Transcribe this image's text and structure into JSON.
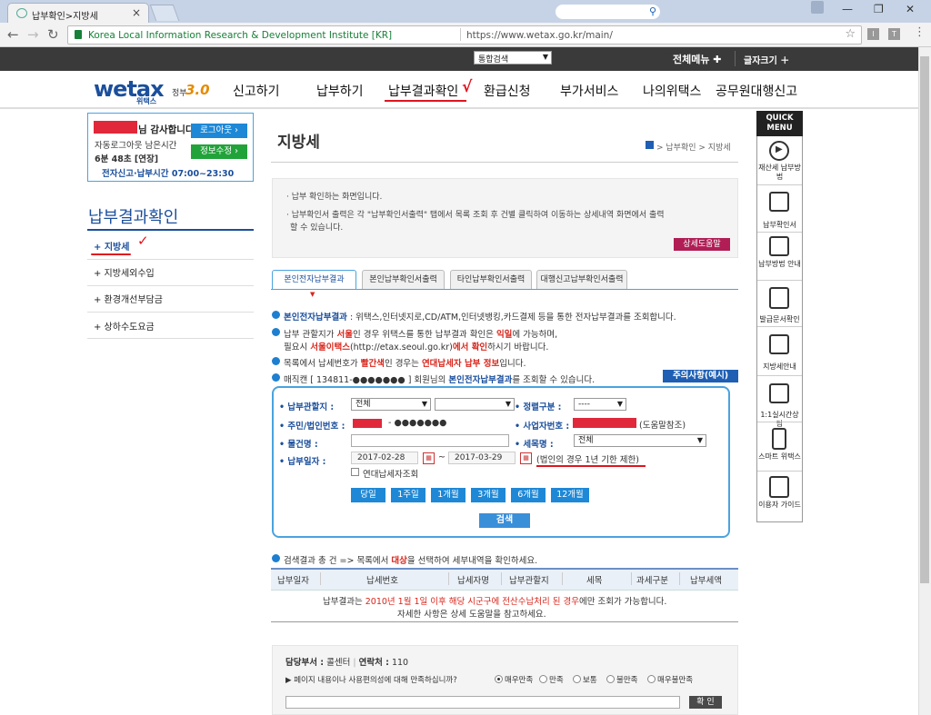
{
  "browser": {
    "tab_title": "납부확인>지방세",
    "site_identity": "Korea Local Information Research & Development Institute [KR]",
    "url": "https://www.wetax.go.kr/main/"
  },
  "topbar": {
    "search_scope": "통합검색",
    "all_menu": "전체메뉴 ✚",
    "font_size": "글자크기 ＋"
  },
  "header": {
    "logo": "wetax",
    "logo_sub": "위택스",
    "gov_label": "정부",
    "gov_version": "3.0",
    "menu": [
      "신고하기",
      "납부하기",
      "납부결과확인",
      "환급신청",
      "부가서비스",
      "나의위택스",
      "공무원대행신고"
    ]
  },
  "login": {
    "greeting": "님 감사합니다.",
    "logout": "로그아웃 ›",
    "autologout": "자동로그아웃 남은시간",
    "remaining": "6분 48초 [연장]",
    "edit_info": "정보수정 ›",
    "hours": "전자신고·납부시간 07:00~23:30"
  },
  "sidebar": {
    "title": "납부결과확인",
    "items": [
      "+ 지방세",
      "+ 지방세외수입",
      "+ 환경개선부담금",
      "+ 상하수도요금"
    ]
  },
  "content": {
    "page_title": "지방세",
    "breadcrumb": "> 납부확인 > 지방세",
    "info_lines": [
      "· 납부 확인하는 화면입니다.",
      "· 납부확인서 출력은 각 \"납부확인서출력\" 탭에서 목록 조회 후 건별 클릭하여 이동하는 상세내역 화면에서 출력",
      "할 수 있습니다."
    ],
    "help_button": "상세도움말",
    "tabs": [
      "본인전자납부결과",
      "본인납부확인서출력",
      "타인납부확인서출력",
      "대행신고납부확인서출력"
    ],
    "notice1_a": "본인전자납부결과",
    "notice1_b": " : 위택스,인터넷지로,CD/ATM,인터넷뱅킹,카드결제 등을 통한 전자납부결과를 조회합니다.",
    "notice2_a": "납부 관할지가 ",
    "notice2_b": "서울",
    "notice2_c": "인 경우 위택스를 통한 납부결과 확인은 ",
    "notice2_d": "익일",
    "notice2_e": "에 가능하며,",
    "notice2b_a": "필요시 ",
    "notice2b_b": "서울이택스",
    "notice2b_c": "(http://etax.seoul.go.kr)",
    "notice2b_d": "에서 확인",
    "notice2b_e": "하시기 바랍니다.",
    "notice3_a": "목록에서 납세번호가 ",
    "notice3_b": "빨간색",
    "notice3_c": "인 경우는 ",
    "notice3_d": "연대납세자 납부 정보",
    "notice3_e": "입니다.",
    "notice4_a": "매직캔 [ 134811-●●●●●●● ] 회원님의 ",
    "notice4_b": "본인전자납부결과",
    "notice4_c": "를 조회할 수 있습니다.",
    "caution_button": "주의사항(예시)"
  },
  "form": {
    "jurisdiction_label": "• 납부관할지 :",
    "jurisdiction_value": "전체",
    "jurisdiction2_value": "",
    "sort_label": "• 정렬구분 :",
    "sort_value": "----",
    "id_label": "• 주민/법인번호 :",
    "id_value": "- ●●●●●●●",
    "biz_label": "• 사업자번호 :",
    "biz_note": "(도움말참조)",
    "item_label": "• 물건명 :",
    "tax_label": "• 세목명 :",
    "tax_value": "전체",
    "date_label": "• 납부일자 :",
    "date_from": "2017-02-28",
    "date_to": "2017-03-29",
    "date_note": "(법인의 경우 1년 기한 제한)",
    "joint_label": "연대납세자조회",
    "periods": [
      "당일",
      "1주일",
      "1개월",
      "3개월",
      "6개월",
      "12개월"
    ],
    "search": "검색"
  },
  "results": {
    "summary_a": "검색결과 총 건 => 목록에서 ",
    "summary_b": "대상",
    "summary_c": "을 선택하여 세부내역을 확인하세요.",
    "columns": [
      "납부일자",
      "납세번호",
      "납세자명",
      "납부관할지",
      "세목",
      "과세구분",
      "납부세액"
    ],
    "empty1_a": "납부결과는 ",
    "empty1_b": "2010년 1월 1일 이후 해당 시군구에 전산수납처리 된 경우",
    "empty1_c": "에만 조회가 가능합니다.",
    "empty2": "자세한 사항은 상세 도움말을 참고하세요."
  },
  "feedback": {
    "dept_label": "담당부서 :",
    "dept_value": "콜센터",
    "contact_label": "연락처 :",
    "contact_value": "110",
    "question": "▶ 페이지 내용이나 사용편의성에 대해 만족하십니까?",
    "options": [
      "매우만족",
      "만족",
      "보통",
      "불만족",
      "매우불만족"
    ],
    "confirm": "확 인"
  },
  "quick_menu": {
    "title": "QUICK MENU",
    "items": [
      "재산세 납부방법",
      "납부확인서",
      "납부방법 안내",
      "발급문서확인",
      "지방세안내",
      "1:1실시간상담",
      "스마트 위택스",
      "이용자 가이드"
    ]
  },
  "colors": {
    "brand": "#1b4f9c",
    "accent": "#d9261c",
    "button": "#1e88d6"
  }
}
